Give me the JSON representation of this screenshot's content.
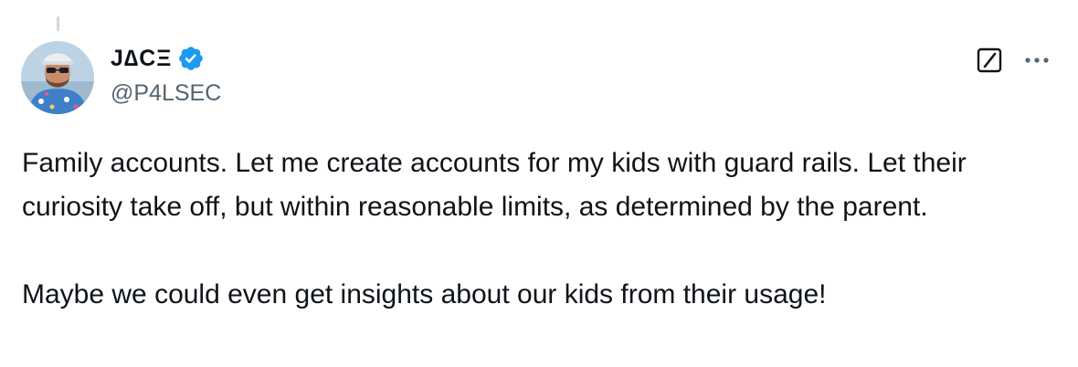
{
  "author": {
    "display_name": "J∆CΞ",
    "handle": "@P4LSEC",
    "verified": true,
    "verified_color": "#1d9bf0",
    "avatar_icon": "avatar-photo"
  },
  "actions": {
    "grok_icon": "grok-icon",
    "more_icon": "more-icon"
  },
  "tweet": {
    "paragraphs": [
      "Family accounts. Let me create accounts for my kids with guard rails. Let their curiosity take off, but within reasonable limits, as determined by the parent.",
      "Maybe we could even get insights about our kids from their usage!"
    ]
  },
  "colors": {
    "text": "#0f1419",
    "secondary": "#536471",
    "accent": "#1d9bf0"
  }
}
